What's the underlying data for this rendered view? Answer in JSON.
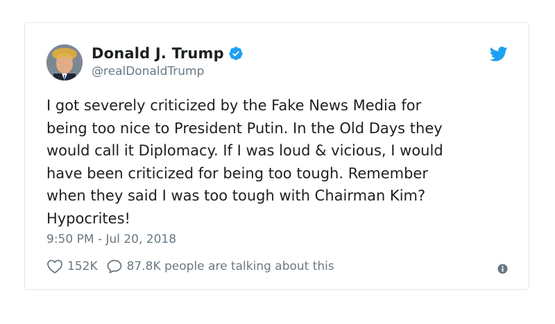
{
  "author": {
    "display_name": "Donald J. Trump",
    "handle": "@realDonaldTrump",
    "verified": true
  },
  "tweet": {
    "text": "I got severely criticized by the Fake News Media for\nbeing too nice to President Putin. In the Old Days they\nwould call it Diplomacy. If I was loud & vicious, I would\nhave been criticized for being too tough. Remember\nwhen they said I was too tough with Chairman Kim?\nHypocrites!",
    "timestamp": "9:50 PM - Jul 20, 2018"
  },
  "actions": {
    "likes": "152K",
    "conversation": "87.8K people are talking about this"
  },
  "icons": {
    "brand": "twitter-bird-icon",
    "verified": "verified-badge-icon",
    "like": "heart-icon",
    "reply": "speech-bubble-icon",
    "info": "info-icon"
  },
  "colors": {
    "brand_blue": "#1da1f2",
    "text_primary": "#1c2022",
    "text_secondary": "#697882",
    "border": "#e1e8ed"
  }
}
